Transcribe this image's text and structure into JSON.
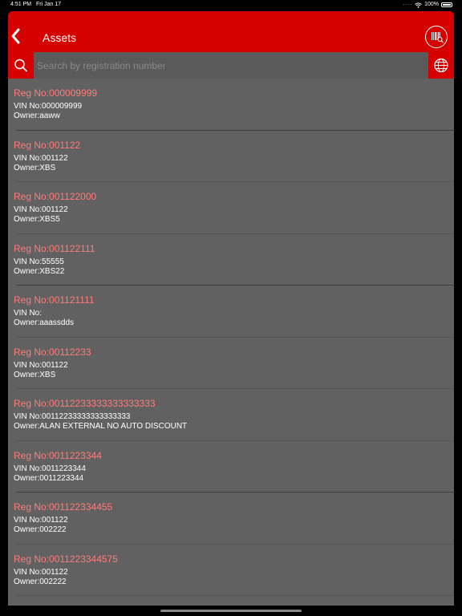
{
  "status_bar": {
    "time": "4:51 PM",
    "date": "Fri Jan 17",
    "battery": "100%"
  },
  "header": {
    "title": "Assets",
    "accent_color": "#d50000"
  },
  "search": {
    "placeholder": "Search by registration number"
  },
  "assets": [
    {
      "reg": "Reg No:000009999",
      "vin": "VIN No:000009999",
      "owner": "Owner:aaww"
    },
    {
      "reg": "Reg No:001122",
      "vin": "VIN No:001122",
      "owner": "Owner:XBS"
    },
    {
      "reg": "Reg No:001122000",
      "vin": "VIN No:001122",
      "owner": "Owner:XBS5"
    },
    {
      "reg": "Reg No:001122111",
      "vin": "VIN No:55555",
      "owner": "Owner:XBS22"
    },
    {
      "reg": "Reg No:001121111",
      "vin": "VIN No:",
      "owner": "Owner:aaassdds"
    },
    {
      "reg": "Reg No:00112233",
      "vin": "VIN No:001122",
      "owner": "Owner:XBS"
    },
    {
      "reg": "Reg No:00112233333333333333",
      "vin": "VIN No:00112233333333333333",
      "owner": "Owner:ALAN EXTERNAL NO AUTO DISCOUNT"
    },
    {
      "reg": "Reg No:0011223344",
      "vin": "VIN No:0011223344",
      "owner": "Owner:0011223344"
    },
    {
      "reg": "Reg No:001122334455",
      "vin": "VIN No:001122",
      "owner": "Owner:002222"
    },
    {
      "reg": "Reg No:0011223344575",
      "vin": "VIN No:001122",
      "owner": "Owner:002222"
    }
  ]
}
